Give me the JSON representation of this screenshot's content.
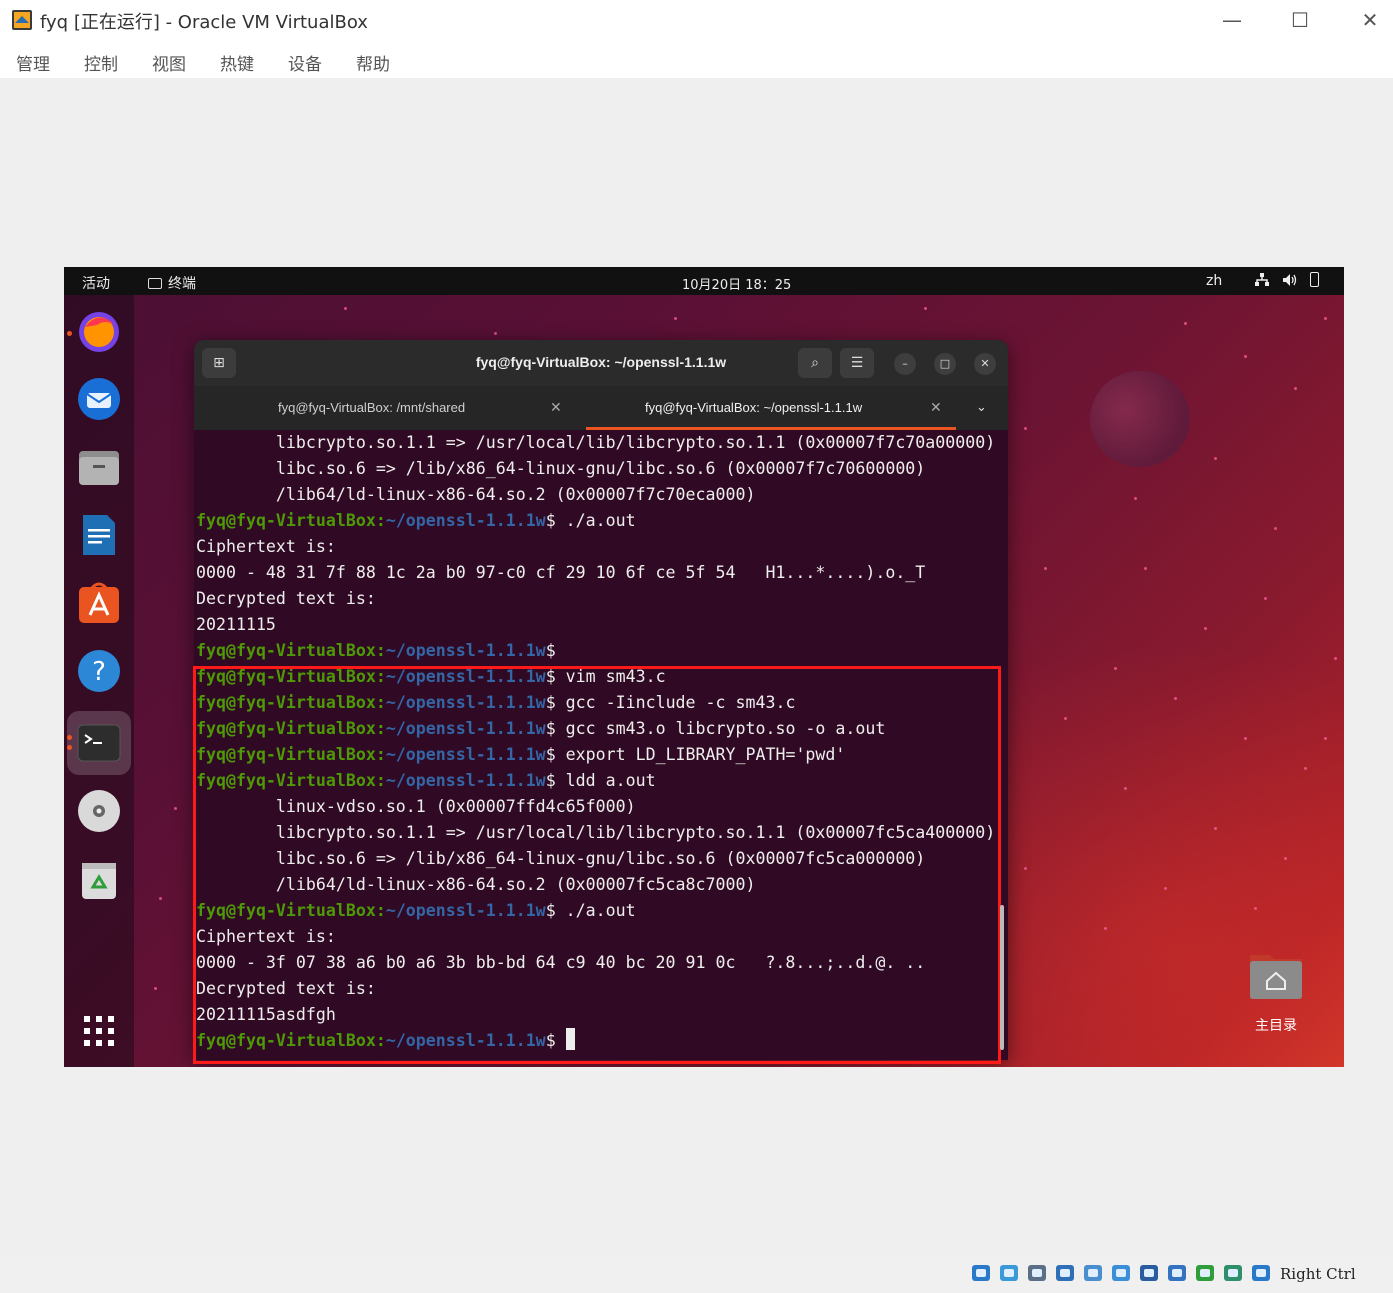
{
  "window": {
    "title": "fyq [正在运行] - Oracle VM VirtualBox",
    "minimize": "—",
    "maximize": "☐",
    "close": "✕"
  },
  "menu": [
    "管理",
    "控制",
    "视图",
    "热键",
    "设备",
    "帮助"
  ],
  "guest": {
    "topbar": {
      "activities": "活动",
      "app": "终端",
      "clock": "10月20日 18：25",
      "lang": "zh"
    },
    "desktop": {
      "home_label": "主目录"
    },
    "terminal": {
      "title": "fyq@fyq-VirtualBox: ~/openssl-1.1.1w",
      "tabs": [
        {
          "label": "fyq@fyq-VirtualBox: /mnt/shared",
          "active": false
        },
        {
          "label": "fyq@fyq-VirtualBox: ~/openssl-1.1.1w",
          "active": true
        }
      ],
      "prompt_user": "fyq@fyq-VirtualBox",
      "prompt_path": "~/openssl-1.1.1w",
      "lines": [
        {
          "t": "out",
          "text": "        libcrypto.so.1.1 => /usr/local/lib/libcrypto.so.1.1 (0x00007f7c70a00000)"
        },
        {
          "t": "out",
          "text": "        libc.so.6 => /lib/x86_64-linux-gnu/libc.so.6 (0x00007f7c70600000)"
        },
        {
          "t": "out",
          "text": "        /lib64/ld-linux-x86-64.so.2 (0x00007f7c70eca000)"
        },
        {
          "t": "cmd",
          "text": " ./a.out"
        },
        {
          "t": "out",
          "text": "Ciphertext is:"
        },
        {
          "t": "out",
          "text": "0000 - 48 31 7f 88 1c 2a b0 97-c0 cf 29 10 6f ce 5f 54   H1...*....).o._T"
        },
        {
          "t": "out",
          "text": "Decrypted text is:"
        },
        {
          "t": "out",
          "text": "20211115"
        },
        {
          "t": "cmd",
          "text": ""
        },
        {
          "t": "cmd",
          "text": " vim sm43.c"
        },
        {
          "t": "cmd",
          "text": " gcc -Iinclude -c sm43.c"
        },
        {
          "t": "cmd",
          "text": " gcc sm43.o libcrypto.so -o a.out"
        },
        {
          "t": "cmd",
          "text": " export LD_LIBRARY_PATH='pwd'"
        },
        {
          "t": "cmd",
          "text": " ldd a.out"
        },
        {
          "t": "out",
          "text": "        linux-vdso.so.1 (0x00007ffd4c65f000)"
        },
        {
          "t": "out",
          "text": "        libcrypto.so.1.1 => /usr/local/lib/libcrypto.so.1.1 (0x00007fc5ca400000)"
        },
        {
          "t": "out",
          "text": "        libc.so.6 => /lib/x86_64-linux-gnu/libc.so.6 (0x00007fc5ca000000)"
        },
        {
          "t": "out",
          "text": "        /lib64/ld-linux-x86-64.so.2 (0x00007fc5ca8c7000)"
        },
        {
          "t": "cmd",
          "text": " ./a.out"
        },
        {
          "t": "out",
          "text": "Ciphertext is:"
        },
        {
          "t": "out",
          "text": "0000 - 3f 07 38 a6 b0 a6 3b bb-bd 64 c9 40 bc 20 91 0c   ?.8...;..d.@. .."
        },
        {
          "t": "out",
          "text": "Decrypted text is:"
        },
        {
          "t": "out",
          "text": "20211115asdfgh"
        },
        {
          "t": "cmd",
          "text": " ",
          "cursor": true
        }
      ]
    },
    "dock": [
      "firefox-icon",
      "thunderbird-icon",
      "files-icon",
      "writer-icon",
      "software-icon",
      "help-icon",
      "terminal-icon",
      "dvd-icon",
      "trash-icon",
      "show-apps-icon"
    ]
  },
  "statusbar": {
    "icons": [
      "hdd-icon",
      "optical-icon",
      "audio-icon",
      "network-icon",
      "usb-icon",
      "shared-folder-icon",
      "display-icon",
      "recording-icon",
      "cpu-icon",
      "mouse-integration-icon",
      "keyboard-icon"
    ],
    "host_key": "Right Ctrl"
  }
}
